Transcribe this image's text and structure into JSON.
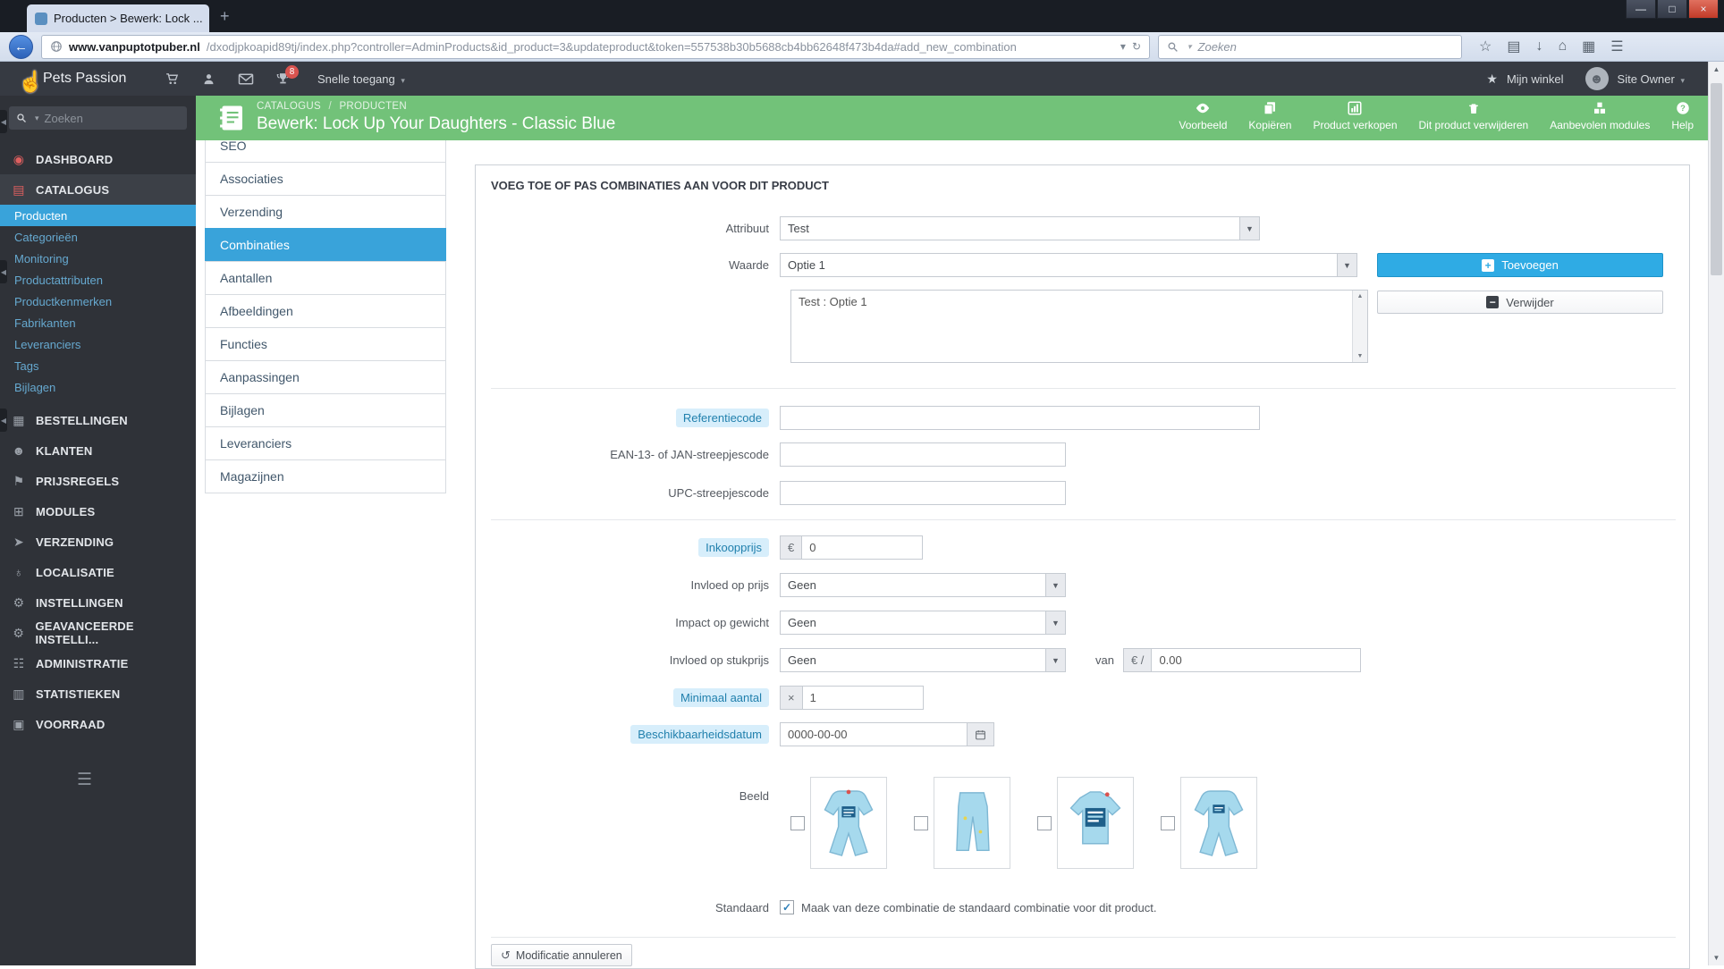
{
  "browser": {
    "tab_title": "Producten > Bewerk: Lock ...",
    "tab_close": "×",
    "new_tab": "+",
    "url_domain": "www.vanpuptotpuber.nl",
    "url_path": "/dxodjpkoapid89tj/index.php?controller=AdminProducts&id_product=3&updateproduct&token=557538b30b5688cb4bb62648f473b4da#add_new_combination",
    "url_dropdown": "▾",
    "reload": "↻",
    "search_placeholder": "Zoeken",
    "back": "←",
    "window": {
      "minimize": "—",
      "maximize": "□",
      "close": "×"
    },
    "toolbar_icons": {
      "star": "☆",
      "bookmarks": "▤",
      "download": "↓",
      "home": "⌂",
      "apps": "▦",
      "menu": "☰"
    }
  },
  "topbar": {
    "brand": "Pets Passion",
    "notification_count": "8",
    "quick_access": "Snelle toegang",
    "my_shop_star": "★",
    "my_shop": "Mijn winkel",
    "user": "Site Owner",
    "caret": "▾"
  },
  "sidebar": {
    "search_placeholder": "Zoeken",
    "burger": "☰",
    "items": [
      {
        "label": "DASHBOARD",
        "icon": "◉"
      },
      {
        "label": "CATALOGUS",
        "icon": "▤"
      },
      {
        "label": "BESTELLINGEN",
        "icon": "▦"
      },
      {
        "label": "KLANTEN",
        "icon": "☻"
      },
      {
        "label": "PRIJSREGELS",
        "icon": "⚑"
      },
      {
        "label": "MODULES",
        "icon": "⊞"
      },
      {
        "label": "VERZENDING",
        "icon": "➤"
      },
      {
        "label": "LOCALISATIE",
        "icon": "♁"
      },
      {
        "label": "INSTELLINGEN",
        "icon": "⚙"
      },
      {
        "label": "GEAVANCEERDE INSTELLI...",
        "icon": "⚙"
      },
      {
        "label": "ADMINISTRATIE",
        "icon": "☷"
      },
      {
        "label": "STATISTIEKEN",
        "icon": "▥"
      },
      {
        "label": "VOORRAAD",
        "icon": "▣"
      }
    ],
    "catalog_sub": [
      {
        "label": "Producten"
      },
      {
        "label": "Categorieën"
      },
      {
        "label": "Monitoring"
      },
      {
        "label": "Productattributen"
      },
      {
        "label": "Productkenmerken"
      },
      {
        "label": "Fabrikanten"
      },
      {
        "label": "Leveranciers"
      },
      {
        "label": "Tags"
      },
      {
        "label": "Bijlagen"
      }
    ]
  },
  "page_header": {
    "breadcrumb_1": "CATALOGUS",
    "breadcrumb_sep": "/",
    "breadcrumb_2": "PRODUCTEN",
    "title": "Bewerk: Lock Up Your Daughters - Classic Blue",
    "actions": [
      {
        "label": "Voorbeeld"
      },
      {
        "label": "Kopiëren"
      },
      {
        "label": "Product verkopen"
      },
      {
        "label": "Dit product verwijderen"
      },
      {
        "label": "Aanbevolen modules"
      },
      {
        "label": "Help"
      }
    ]
  },
  "product_tabs": [
    {
      "label": "SEO"
    },
    {
      "label": "Associaties"
    },
    {
      "label": "Verzending"
    },
    {
      "label": "Combinaties"
    },
    {
      "label": "Aantallen"
    },
    {
      "label": "Afbeeldingen"
    },
    {
      "label": "Functies"
    },
    {
      "label": "Aanpassingen"
    },
    {
      "label": "Bijlagen"
    },
    {
      "label": "Leveranciers"
    },
    {
      "label": "Magazijnen"
    }
  ],
  "form": {
    "section_title": "VOEG TOE OF PAS COMBINATIES AAN VOOR DIT PRODUCT",
    "attribute": {
      "label": "Attribuut",
      "value": "Test"
    },
    "value": {
      "label": "Waarde",
      "value": "Optie 1"
    },
    "add_button": "Toevoegen",
    "remove_button": "Verwijder",
    "combination_list": "Test : Optie 1",
    "reference": {
      "label": "Referentiecode",
      "value": ""
    },
    "ean": {
      "label": "EAN-13- of JAN-streepjescode",
      "value": ""
    },
    "upc": {
      "label": "UPC-streepjescode",
      "value": ""
    },
    "wholesale": {
      "label": "Inkoopprijs",
      "prefix": "€",
      "value": "0"
    },
    "price_impact": {
      "label": "Invloed op prijs",
      "value": "Geen"
    },
    "weight_impact": {
      "label": "Impact op gewicht",
      "value": "Geen"
    },
    "unit_price_impact": {
      "label": "Invloed op stukprijs",
      "value": "Geen",
      "of_label": "van",
      "prefix": "€ /",
      "amount": "0.00"
    },
    "min_quantity": {
      "label": "Minimaal aantal",
      "prefix": "×",
      "value": "1"
    },
    "availability_date": {
      "label": "Beschikbaarheidsdatum",
      "value": "0000-00-00"
    },
    "image": {
      "label": "Beeld",
      "items": [
        {
          "name": "romper-front"
        },
        {
          "name": "pants"
        },
        {
          "name": "sweater-front"
        },
        {
          "name": "romper-back"
        }
      ]
    },
    "default": {
      "label": "Standaard",
      "check": "✓",
      "text": "Maak van deze combinatie de standaard combinatie voor dit product."
    },
    "cancel_button": "Modificatie annuleren"
  }
}
